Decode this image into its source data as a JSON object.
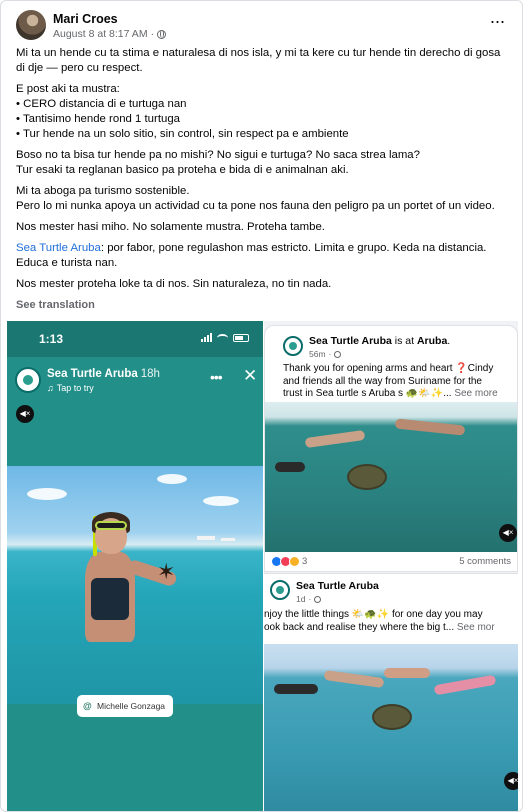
{
  "post": {
    "author": "Mari Croes",
    "timestamp": "August 8 at 8:17 AM",
    "separator": "·",
    "more_label": "···",
    "paragraphs": {
      "p1": "Mi ta un hende cu ta stima e naturalesa di nos isla, y mi ta kere cu tur hende tin derecho di gosa di dje — pero cu respect.",
      "p2_intro": "E post aki ta mustra:",
      "p2_b1": "• CERO distancia di e turtuga nan",
      "p2_b2": "• Tantisimo hende rond 1 turtuga",
      "p2_b3": "• Tur hende na un solo sitio, sin control, sin respect pa e ambiente",
      "p3_l1": "Boso no ta bisa tur hende pa no mishi? No sigui e turtuga? No saca strea lama?",
      "p3_l2": "Tur esaki ta reglanan basico pa proteha e bida di e animalnan aki.",
      "p4_l1": "Mi ta aboga pa turismo sostenible.",
      "p4_l2": "Pero lo mi nunka apoya un actividad cu ta pone nos fauna den peligro pa un portet of un video.",
      "p5": "Nos mester hasi miho. No solamente mustra. Proteha tambe.",
      "p6_link": "Sea Turtle Aruba",
      "p6_rest": ": por fabor, pone regulashon mas estricto. Limita e grupo. Keda na distancia. Educa e turista nan.",
      "p7": "Nos mester proteha loke ta di nos. Sin naturaleza, no tin nada."
    },
    "see_translation": "See translation"
  },
  "story": {
    "time": "1:13",
    "page_name": "Sea Turtle Aruba",
    "age": "18h",
    "audio_label": "Tap to try",
    "more_label": "•••",
    "close_label": "✕",
    "mute_icon": "◀×",
    "tag": "Michelle Gonzaga"
  },
  "feed": {
    "card1": {
      "page_name": "Sea Turtle Aruba",
      "is_at": " is at ",
      "location": "Aruba",
      "age": "56m",
      "text_l1": "Thank you for opening arms and heart ❓Cindy",
      "text_l2": "and friends all the way from Suriname for the",
      "text_l3": "trust in Sea turtle s Aruba s 🐢🌤️✨... ",
      "see_more": "See more",
      "reactions_count": "3",
      "comments": "5 comments"
    },
    "card2": {
      "page_name": "Sea Turtle Aruba",
      "age": "1d",
      "text_l1": "njoy the little things 🌤️🐢✨ for one day you may",
      "text_l2": "ook back and realise they where the big t... ",
      "see_more": "See mor"
    }
  },
  "colors": {
    "link": "#216fdb",
    "muted": "#65676b",
    "story_teal": "#238f89"
  }
}
